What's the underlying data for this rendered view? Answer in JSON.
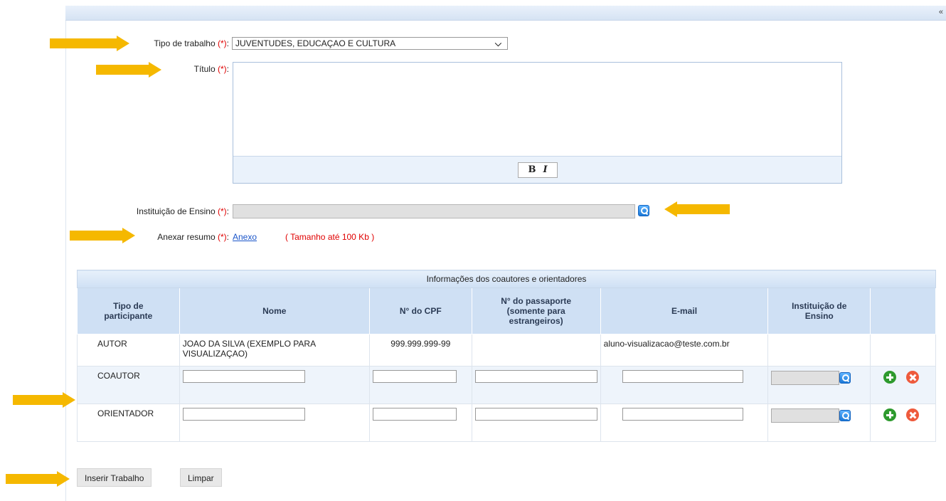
{
  "header": {
    "collapse_glyph": "«"
  },
  "form": {
    "tipo_label": "Tipo de trabalho",
    "required_marker": "(*)",
    "colon": ":",
    "tipo_value": "JUVENTUDES, EDUCAÇAO E CULTURA",
    "titulo_label": "Título",
    "titulo_value": "",
    "editor_bold": "B",
    "editor_italic": "I",
    "instituicao_label": "Instituição de Ensino",
    "anexar_label": "Anexar resumo",
    "anexo_link": "Anexo",
    "tamanho_note": "( Tamanho até 100 Kb )"
  },
  "table": {
    "caption": "Informações dos coautores e orientadores",
    "headers": [
      "Tipo de participante",
      "Nome",
      "N° do CPF",
      "N° do passaporte (somente para estrangeiros)",
      "E-mail",
      "Instituição de Ensino",
      ""
    ],
    "rows": [
      {
        "tipo": "AUTOR",
        "nome": "JOAO DA SILVA (EXEMPLO PARA VISUALIZAÇAO)",
        "cpf": "999.999.999-99",
        "passaporte": "",
        "email": "aluno-visualizacao@teste.com.br",
        "instituicao": ""
      },
      {
        "tipo": "COAUTOR"
      },
      {
        "tipo": "ORIENTADOR"
      }
    ]
  },
  "actions": {
    "inserir": "Inserir Trabalho",
    "limpar": "Limpar"
  },
  "colors": {
    "arrow": "#f5b800",
    "required": "#e00000",
    "link": "#1a55c9",
    "header_bg": "#cfe0f4"
  }
}
